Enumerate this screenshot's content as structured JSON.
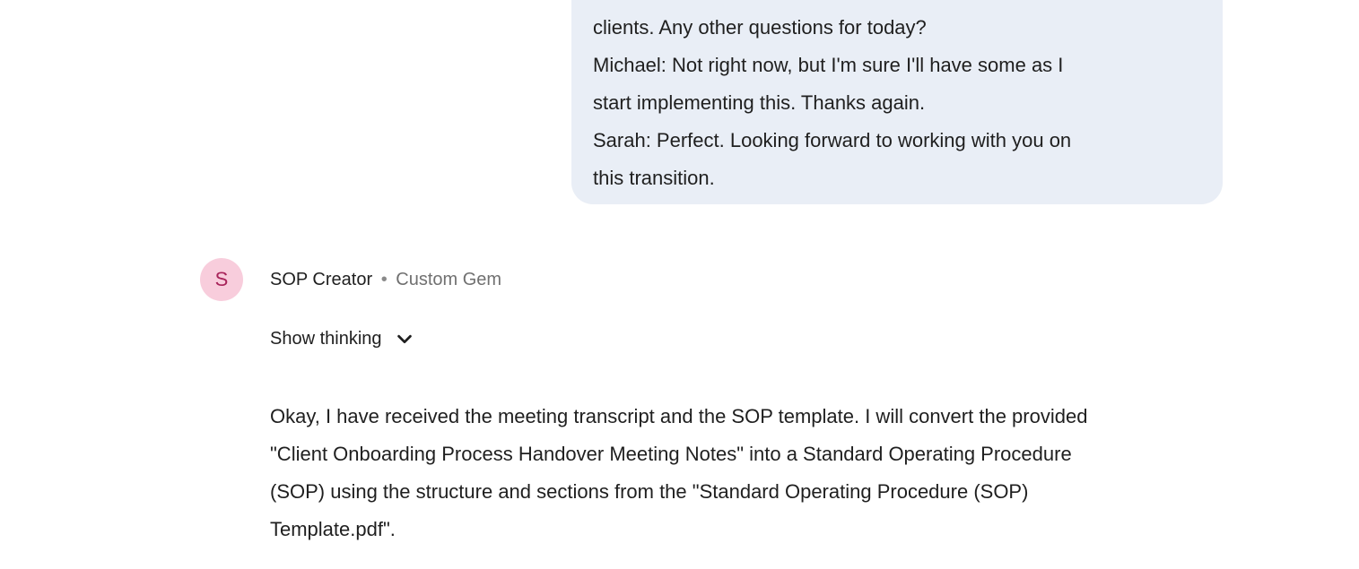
{
  "user_message": {
    "lines": [
      "clients. Any other questions for today?",
      "Michael: Not right now, but I'm sure I'll have some as I",
      "start implementing this. Thanks again.",
      "Sarah: Perfect. Looking forward to working with you on",
      "this transition."
    ]
  },
  "model": {
    "avatar_letter": "S",
    "name": "SOP Creator",
    "separator": "•",
    "type": "Custom Gem",
    "show_thinking_label": "Show thinking",
    "response_lines": [
      "Okay, I have received the meeting transcript and the SOP template. I will convert the provided",
      "\"Client Onboarding Process Handover Meeting Notes\" into a Standard Operating Procedure",
      "(SOP) using the structure and sections from the \"Standard Operating Procedure (SOP)",
      "Template.pdf\"."
    ]
  },
  "colors": {
    "bubble_bg": "#e9eef6",
    "avatar_bg": "#f8cddc",
    "avatar_fg": "#a8245a"
  }
}
